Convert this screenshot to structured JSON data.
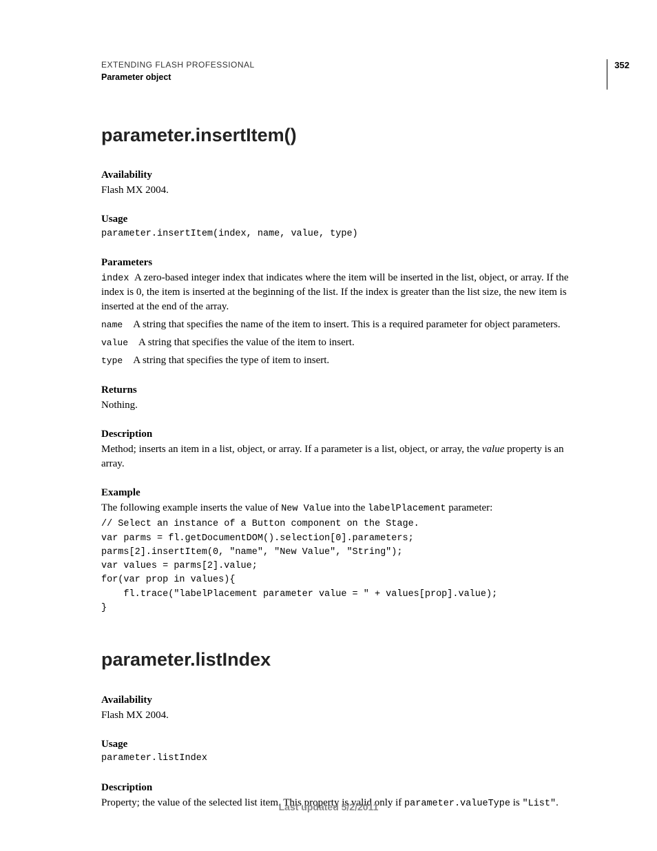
{
  "header": {
    "title": "EXTENDING FLASH PROFESSIONAL",
    "subtitle": "Parameter object",
    "page_number": "352"
  },
  "section1": {
    "heading": "parameter.insertItem()",
    "availability_label": "Availability",
    "availability_text": "Flash MX 2004.",
    "usage_label": "Usage",
    "usage_code": "parameter.insertItem(index, name, value, type)",
    "parameters_label": "Parameters",
    "param_index_name": "index",
    "param_index_text": "A zero-based integer index that indicates where the item will be inserted in the list, object, or array. If the index is 0, the item is inserted at the beginning of the list. If the index is greater than the list size, the new item is inserted at the end of the array.",
    "param_name_name": "name",
    "param_name_text": "A string that specifies the name of the item to insert. This is a required parameter for object parameters.",
    "param_value_name": "value",
    "param_value_text": "A string that specifies the value of the item to insert.",
    "param_type_name": "type",
    "param_type_text": "A string that specifies the type of item to insert.",
    "returns_label": "Returns",
    "returns_text": "Nothing.",
    "description_label": "Description",
    "description_prefix": "Method; inserts an item in a list, object, or array. If a parameter is a list, object, or array, the ",
    "description_value": "value",
    "description_suffix": " property is an array.",
    "example_label": "Example",
    "example_text_prefix": "The following example inserts the value of ",
    "example_text_code1": "New Value",
    "example_text_mid": " into the ",
    "example_text_code2": "labelPlacement",
    "example_text_suffix": " parameter:",
    "example_code": "// Select an instance of a Button component on the Stage.\nvar parms = fl.getDocumentDOM().selection[0].parameters;\nparms[2].insertItem(0, \"name\", \"New Value\", \"String\");\nvar values = parms[2].value;\nfor(var prop in values){\n    fl.trace(\"labelPlacement parameter value = \" + values[prop].value);\n}"
  },
  "section2": {
    "heading": "parameter.listIndex",
    "availability_label": "Availability",
    "availability_text": "Flash MX 2004.",
    "usage_label": "Usage",
    "usage_code": "parameter.listIndex",
    "description_label": "Description",
    "description_prefix": "Property; the value of the selected list item. This property is valid only if ",
    "description_code1": "parameter.valueType",
    "description_mid": " is ",
    "description_code2": "\"List\"",
    "description_suffix": "."
  },
  "footer": "Last updated 5/2/2011"
}
